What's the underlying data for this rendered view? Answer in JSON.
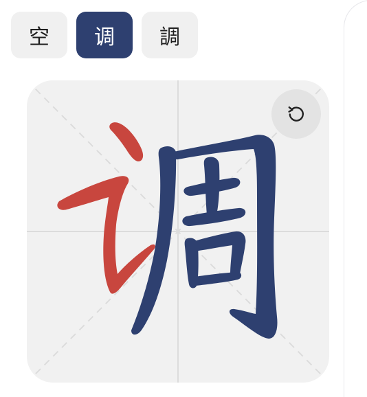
{
  "tabs": [
    {
      "label": "空",
      "active": false
    },
    {
      "label": "调",
      "active": true
    },
    {
      "label": "調",
      "active": false
    }
  ],
  "board": {
    "character": "调",
    "replay_icon": "rotate-ccw-icon",
    "colors": {
      "completed_stroke": "#c8463e",
      "pending_strokes": "#2e4070",
      "active_tab": "#2e4070"
    }
  }
}
